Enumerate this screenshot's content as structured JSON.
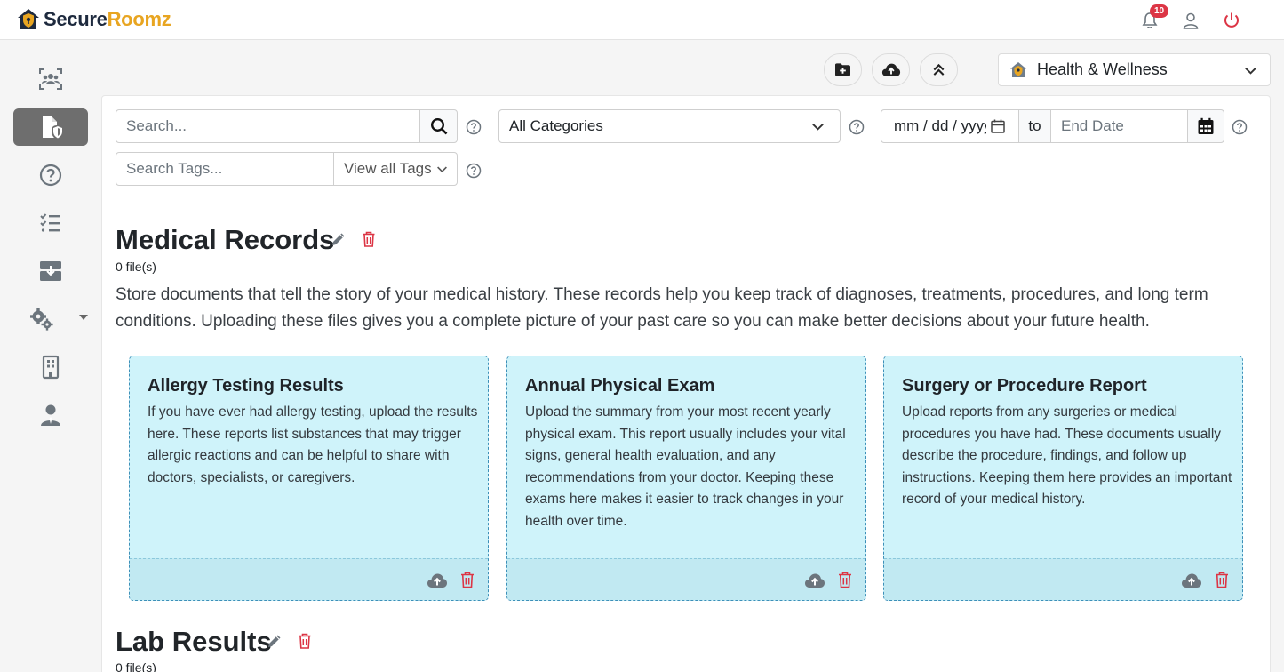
{
  "app": {
    "brand_first": "Secure",
    "brand_second": "Roomz",
    "notification_count": "10"
  },
  "toolbar": {
    "room_name": "Health & Wellness"
  },
  "filters": {
    "search_placeholder": "Search...",
    "category_selected": "All Categories",
    "start_date_placeholder": "mm / dd / yyyy",
    "to_label": "to",
    "end_date_placeholder": "End Date",
    "tags_placeholder": "Search Tags...",
    "view_all_tags": "View all Tags"
  },
  "sections": [
    {
      "title": "Medical Records",
      "count": "0 file(s)",
      "description": "Store documents that tell the story of your medical history. These records help you keep track of diagnoses, treatments, procedures, and long term conditions. Uploading these files gives you a complete picture of your past care so you can make better decisions about your future health.",
      "cards": [
        {
          "title": "Allergy Testing Results",
          "description": "If you have ever had allergy testing, upload the results here. These reports list substances that may trigger allergic reactions and can be helpful to share with doctors, specialists, or caregivers."
        },
        {
          "title": "Annual Physical Exam",
          "description": "Upload the summary from your most recent yearly physical exam. This report usually includes your vital signs, general health evaluation, and any recommendations from your doctor. Keeping these exams here makes it easier to track changes in your health over time."
        },
        {
          "title": "Surgery or Procedure Report",
          "description": "Upload reports from any surgeries or medical procedures you have had. These documents usually describe the procedure, findings, and follow up instructions. Keeping them here provides an important record of your medical history."
        }
      ]
    },
    {
      "title": "Lab Results",
      "count": "0 file(s)"
    }
  ],
  "colors": {
    "accent": "#e8a521",
    "brand_dark": "#1e2a3e",
    "danger": "#dc3545",
    "card_bg": "#cff3fa",
    "sidebar_active": "#6e6e6e"
  }
}
